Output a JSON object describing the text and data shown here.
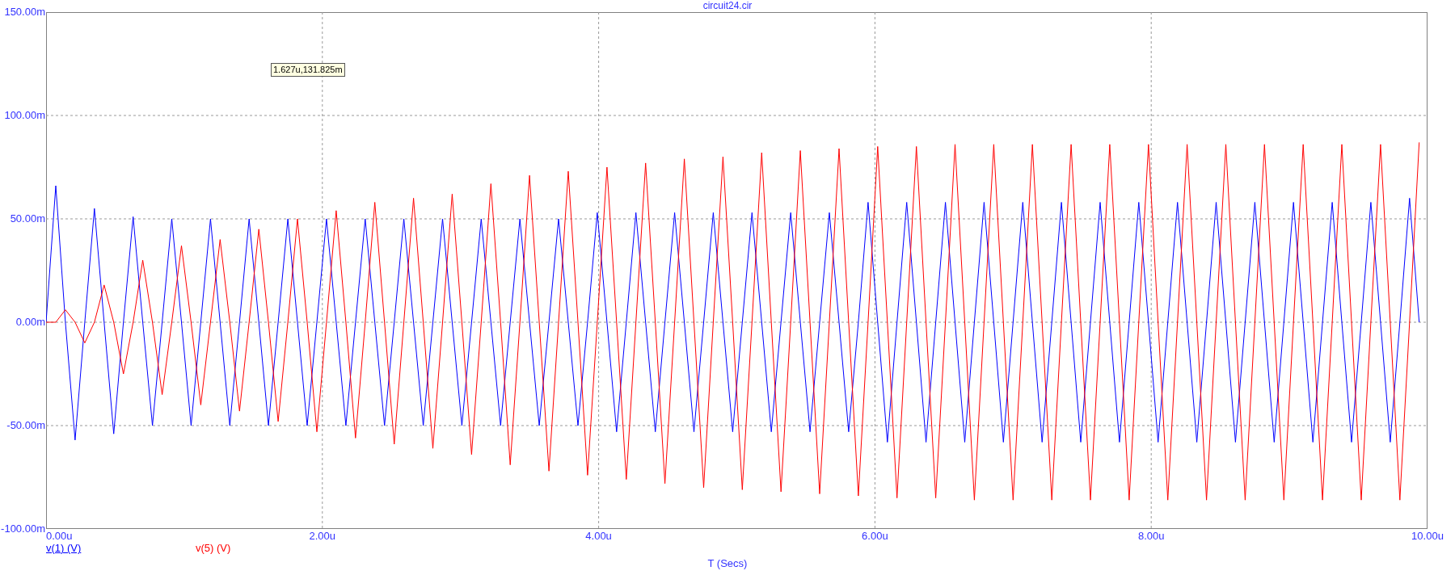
{
  "title": "circuit24.cir",
  "chart_data": {
    "type": "line",
    "grid": true,
    "xlabel": "T (Secs)",
    "xlim": [
      0,
      10
    ],
    "ylim": [
      -100,
      150
    ],
    "xticks": [
      {
        "value": 0,
        "label": "0.00u"
      },
      {
        "value": 2,
        "label": "2.00u"
      },
      {
        "value": 4,
        "label": "4.00u"
      },
      {
        "value": 6,
        "label": "6.00u"
      },
      {
        "value": 8,
        "label": "8.00u"
      },
      {
        "value": 10,
        "label": "10.00u"
      }
    ],
    "yticks": [
      {
        "value": 150,
        "label": "150.00m"
      },
      {
        "value": 100,
        "label": "100.00m"
      },
      {
        "value": 50,
        "label": "50.00m"
      },
      {
        "value": 0,
        "label": "0.00m"
      },
      {
        "value": -50,
        "label": "-50.00m"
      },
      {
        "value": -100,
        "label": "-100.00m"
      }
    ],
    "x": [
      0,
      0.07,
      0.14,
      0.21,
      0.28,
      0.35,
      0.42,
      0.49,
      0.56,
      0.63,
      0.7,
      0.77,
      0.84,
      0.91,
      0.98,
      1.05,
      1.12,
      1.19,
      1.26,
      1.33,
      1.4,
      1.47,
      1.54,
      1.61,
      1.68,
      1.75,
      1.82,
      1.89,
      1.96,
      2.03,
      2.1,
      2.17,
      2.24,
      2.31,
      2.38,
      2.45,
      2.52,
      2.59,
      2.66,
      2.73,
      2.8,
      2.87,
      2.94,
      3.01,
      3.08,
      3.15,
      3.22,
      3.29,
      3.36,
      3.43,
      3.5,
      3.57,
      3.64,
      3.71,
      3.78,
      3.85,
      3.92,
      3.99,
      4.06,
      4.13,
      4.2,
      4.27,
      4.34,
      4.41,
      4.48,
      4.55,
      4.62,
      4.69,
      4.76,
      4.83,
      4.9,
      4.97,
      5.04,
      5.11,
      5.18,
      5.25,
      5.32,
      5.39,
      5.46,
      5.53,
      5.6,
      5.67,
      5.74,
      5.81,
      5.88,
      5.95,
      6.02,
      6.09,
      6.16,
      6.23,
      6.3,
      6.37,
      6.44,
      6.51,
      6.58,
      6.65,
      6.72,
      6.79,
      6.86,
      6.93,
      7,
      7.07,
      7.14,
      7.21,
      7.28,
      7.35,
      7.42,
      7.49,
      7.56,
      7.63,
      7.7,
      7.77,
      7.84,
      7.91,
      7.98,
      8.05,
      8.12,
      8.19,
      8.26,
      8.33,
      8.4,
      8.47,
      8.54,
      8.61,
      8.68,
      8.75,
      8.82,
      8.89,
      8.96,
      9.03,
      9.1,
      9.17,
      9.24,
      9.31,
      9.38,
      9.45,
      9.52,
      9.59,
      9.66,
      9.73,
      9.8,
      9.87,
      9.94
    ],
    "series": [
      {
        "name": "v(1) (V)",
        "color": "#0000ff",
        "values": [
          0,
          66,
          0,
          -57,
          0,
          55,
          0,
          -54,
          0,
          51,
          0,
          -50,
          0,
          50,
          0,
          -50,
          0,
          50,
          0,
          -50,
          0,
          50,
          0,
          -50,
          0,
          50,
          0,
          -50,
          0,
          50,
          0,
          -50,
          0,
          50,
          0,
          -50,
          0,
          50,
          0,
          -50,
          0,
          50,
          0,
          -50,
          0,
          50,
          0,
          -50,
          0,
          50,
          0,
          -50,
          0,
          50,
          0,
          -50,
          0,
          53,
          0,
          -53,
          0,
          53,
          0,
          -53,
          0,
          53,
          0,
          -53,
          0,
          53,
          0,
          -53,
          0,
          53,
          0,
          -53,
          0,
          53,
          0,
          -53,
          0,
          53,
          0,
          -53,
          0,
          58,
          0,
          -58,
          0,
          58,
          0,
          -58,
          0,
          58,
          0,
          -58,
          0,
          58,
          0,
          -58,
          0,
          58,
          0,
          -58,
          0,
          58,
          0,
          -58,
          0,
          58,
          0,
          -58,
          0,
          58,
          0,
          -58,
          0,
          58,
          0,
          -58,
          0,
          58,
          0,
          -58,
          0,
          58,
          0,
          -58,
          0,
          58,
          0,
          -58,
          0,
          58,
          0,
          -58,
          0,
          58,
          0,
          -58,
          0,
          60,
          0
        ]
      },
      {
        "name": "v(5) (V)",
        "color": "#ff0000",
        "values": [
          0,
          0,
          6,
          0,
          -10,
          0,
          18,
          0,
          -25,
          0,
          30,
          0,
          -35,
          0,
          37,
          0,
          -40,
          0,
          40,
          0,
          -43,
          0,
          45,
          0,
          -48,
          0,
          50,
          0,
          -53,
          0,
          54,
          0,
          -56,
          0,
          58,
          0,
          -59,
          0,
          60,
          0,
          -61,
          0,
          62,
          0,
          -64,
          0,
          67,
          0,
          -69,
          0,
          71,
          0,
          -72,
          0,
          73,
          0,
          -74,
          0,
          75,
          0,
          -76,
          0,
          77,
          0,
          -78,
          0,
          79,
          0,
          -80,
          0,
          80,
          0,
          -81,
          0,
          82,
          0,
          -82,
          0,
          83,
          0,
          -83,
          0,
          84,
          0,
          -84,
          0,
          85,
          0,
          -85,
          0,
          85,
          0,
          -85,
          0,
          86,
          0,
          -86,
          0,
          86,
          0,
          -86,
          0,
          86,
          0,
          -86,
          0,
          86,
          0,
          -86,
          0,
          86,
          0,
          -86,
          0,
          86,
          0,
          -86,
          0,
          86,
          0,
          -86,
          0,
          86,
          0,
          -86,
          0,
          86,
          0,
          -86,
          0,
          86,
          0,
          -86,
          0,
          86,
          0,
          -86,
          0,
          86,
          0,
          -86,
          0,
          87
        ]
      }
    ],
    "annotations": [
      "1.627u,131.825m"
    ]
  }
}
